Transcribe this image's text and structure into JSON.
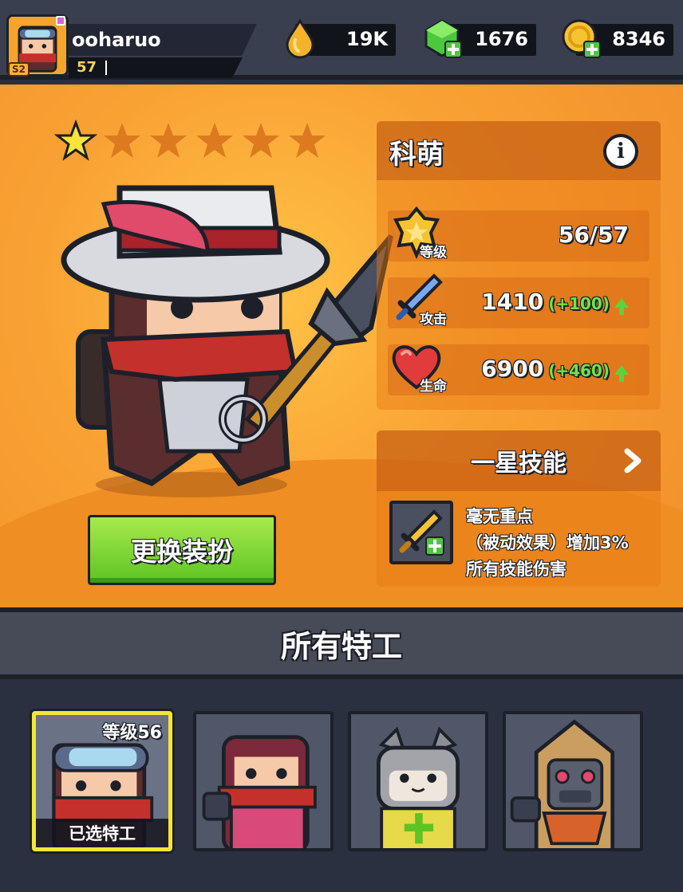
{
  "player": {
    "name": "ooharuo",
    "level": "57",
    "season_badge": "S2"
  },
  "currencies": {
    "elixir": "19K",
    "gems": "1676",
    "coins": "8346"
  },
  "hero": {
    "stars_filled": 1,
    "stars_total": 6,
    "name": "科萌",
    "info_icon_label": "i",
    "stats": {
      "level": {
        "label": "等级",
        "value": "56/57"
      },
      "attack": {
        "label": "攻击",
        "value": "1410",
        "bonus": "(+100)"
      },
      "health": {
        "label": "生命",
        "value": "6900",
        "bonus": "(+460)"
      }
    },
    "change_outfit_label": "更换装扮",
    "skill": {
      "title": "一星技能",
      "line1": "毫无重点",
      "line2": "（被动效果）增加3%",
      "line3": "所有技能伤害"
    }
  },
  "agents": {
    "title": "所有特工",
    "selected": {
      "level_label": "等级56",
      "selected_label": "已选特工"
    }
  },
  "colors": {
    "accent_orange": "#f9a234",
    "button_green": "#5ec323",
    "selected_border": "#f3e53a",
    "bonus_green": "#6ee44a"
  }
}
